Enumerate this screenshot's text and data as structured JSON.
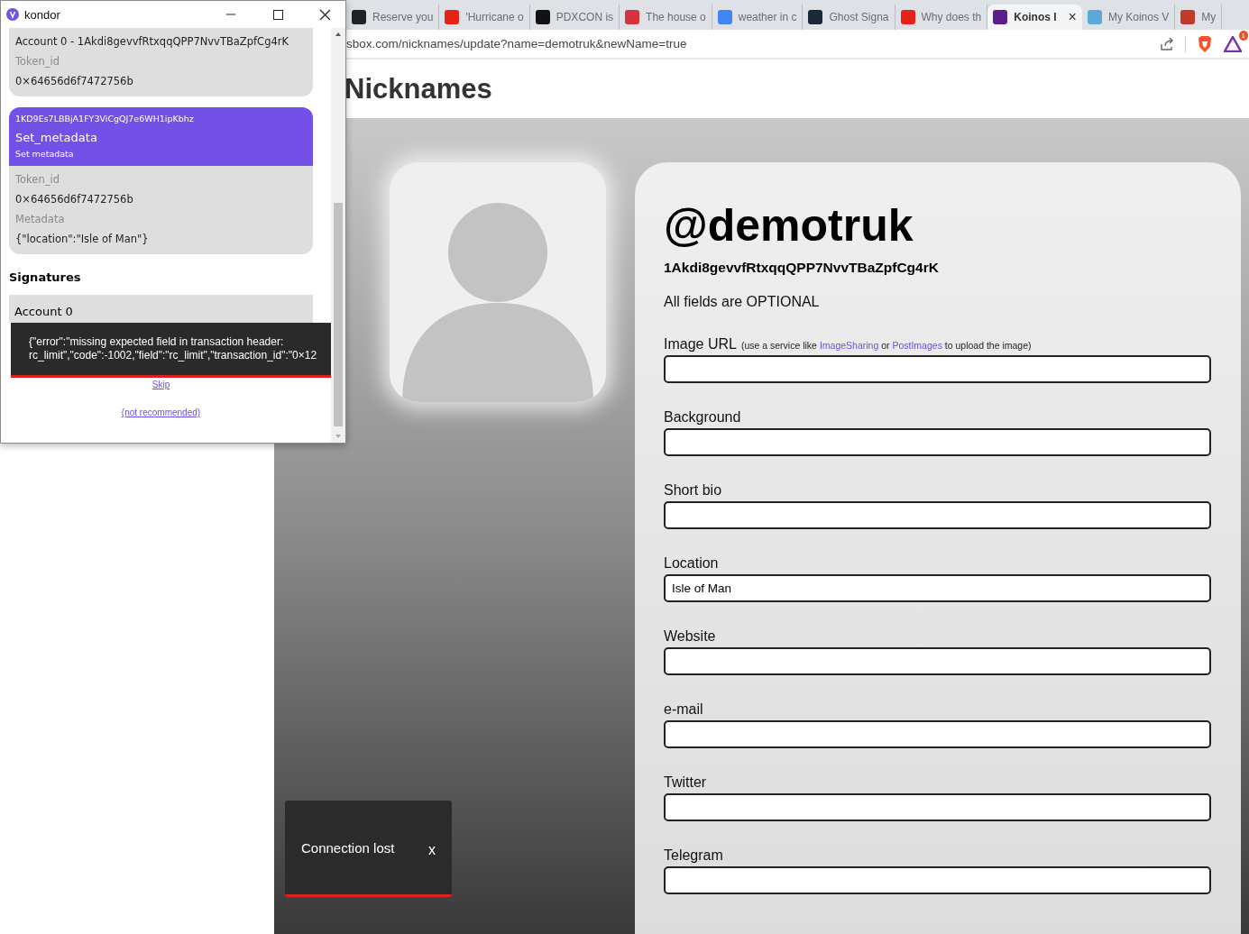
{
  "browser": {
    "tabs": [
      {
        "title": "Reserve you",
        "selected": false,
        "color": "#222222"
      },
      {
        "title": "'Hurricane o",
        "selected": false,
        "color": "#e62117"
      },
      {
        "title": "PDXCON is",
        "selected": false,
        "color": "#111111"
      },
      {
        "title": "The house o",
        "selected": false,
        "color": "#d4323c"
      },
      {
        "title": "weather in c",
        "selected": false,
        "color": "#4285f4"
      },
      {
        "title": "Ghost Signa",
        "selected": false,
        "color": "#1b2838"
      },
      {
        "title": "Why does th",
        "selected": false,
        "color": "#e62117"
      },
      {
        "title": "Koinos I",
        "selected": true,
        "color": "#5a1f8a",
        "close": "×"
      },
      {
        "title": "My Koinos V",
        "selected": false,
        "color": "#5aa9d6"
      },
      {
        "title": "My",
        "selected": false,
        "color": "#c0392b"
      }
    ],
    "address": "sbox.com/nicknames/update?name=demotruk&newName=true",
    "badge": "1"
  },
  "page": {
    "title": "Nicknames",
    "profile": {
      "handle": "@demotruk",
      "address": "1Akdi8gevvfRtxqqQPP7NvvTBaZpfCg4rK",
      "note": "All fields are OPTIONAL",
      "fields": [
        {
          "label": "Image URL",
          "hint": [
            {
              "kind": "text",
              "text": "(use a service like"
            },
            {
              "kind": "link",
              "text": "ImageSharing"
            },
            {
              "kind": "text",
              "text": "or"
            },
            {
              "kind": "link",
              "text": "PostImages"
            },
            {
              "kind": "text",
              "text": "to upload the image)"
            }
          ]
        },
        {
          "label": "Background"
        },
        {
          "label": "Short bio"
        },
        {
          "label": "Location",
          "value": "Isle of Man"
        },
        {
          "label": "Website"
        },
        {
          "label": "e-mail"
        },
        {
          "label": "Twitter"
        },
        {
          "label": "Telegram"
        }
      ]
    },
    "toast": {
      "message": "Connection lost",
      "close": "x"
    }
  },
  "popup": {
    "title": "kondor",
    "cards": [
      {
        "kind": "plain",
        "lines": [
          {
            "kind": "value",
            "text": "Account 0 - 1Akdi8gevvfRtxqqQPP7NvvTBaZpfCg4rK"
          },
          {
            "kind": "label",
            "text": "Token_id"
          },
          {
            "kind": "value",
            "text": "0×64656d6f7472756b"
          }
        ]
      },
      {
        "kind": "operation",
        "contract": "1KD9Es7LBBjA1FY3ViCgQJ7e6WH1ipKbhz",
        "name": "Set_metadata",
        "description": "Set metadata",
        "lines": [
          {
            "kind": "label",
            "text": "Token_id"
          },
          {
            "kind": "value",
            "text": "0×64656d6f7472756b"
          },
          {
            "kind": "label",
            "text": "Metadata"
          },
          {
            "kind": "value",
            "text": "{\"location\":\"Isle of Man\"}"
          }
        ]
      }
    ],
    "signatures_heading": "Signatures",
    "signature": "Account 0",
    "error": "{\"error\":\"missing expected field in transaction header: rc_limit\",\"code\":-1002,\"field\":\"rc_limit\",\"transaction_id\":\"0×12",
    "skip": "Skip",
    "skip_note": "(not recommended)"
  }
}
